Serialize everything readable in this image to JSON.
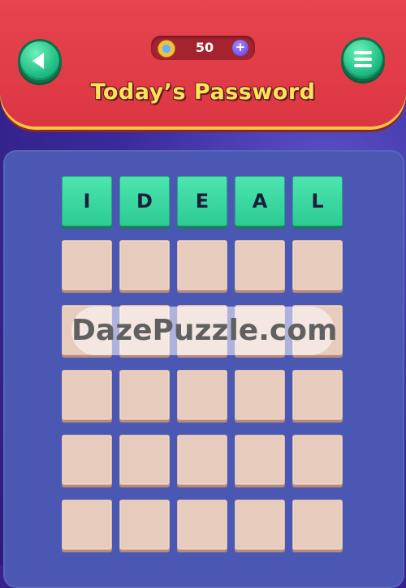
{
  "header": {
    "title": "Today’s Password",
    "coins": "50",
    "plus_symbol": "+"
  },
  "board": {
    "rows": [
      [
        "I",
        "D",
        "E",
        "A",
        "L"
      ],
      [
        "",
        "",
        "",
        "",
        ""
      ],
      [
        "",
        "",
        "",
        "",
        ""
      ],
      [
        "",
        "",
        "",
        "",
        ""
      ],
      [
        "",
        "",
        "",
        "",
        ""
      ],
      [
        "",
        "",
        "",
        "",
        ""
      ]
    ]
  },
  "watermark": "DazePuzzle.com",
  "icons": {
    "back": "back-arrow-icon",
    "menu": "menu-icon",
    "coin": "coin-icon",
    "add": "plus-icon"
  },
  "colors": {
    "header": "#e03b47",
    "accent_green": "#2ccc94",
    "title_yellow": "#fbe45a",
    "board": "#4a58b3",
    "empty_tile": "#e7cbbd"
  }
}
